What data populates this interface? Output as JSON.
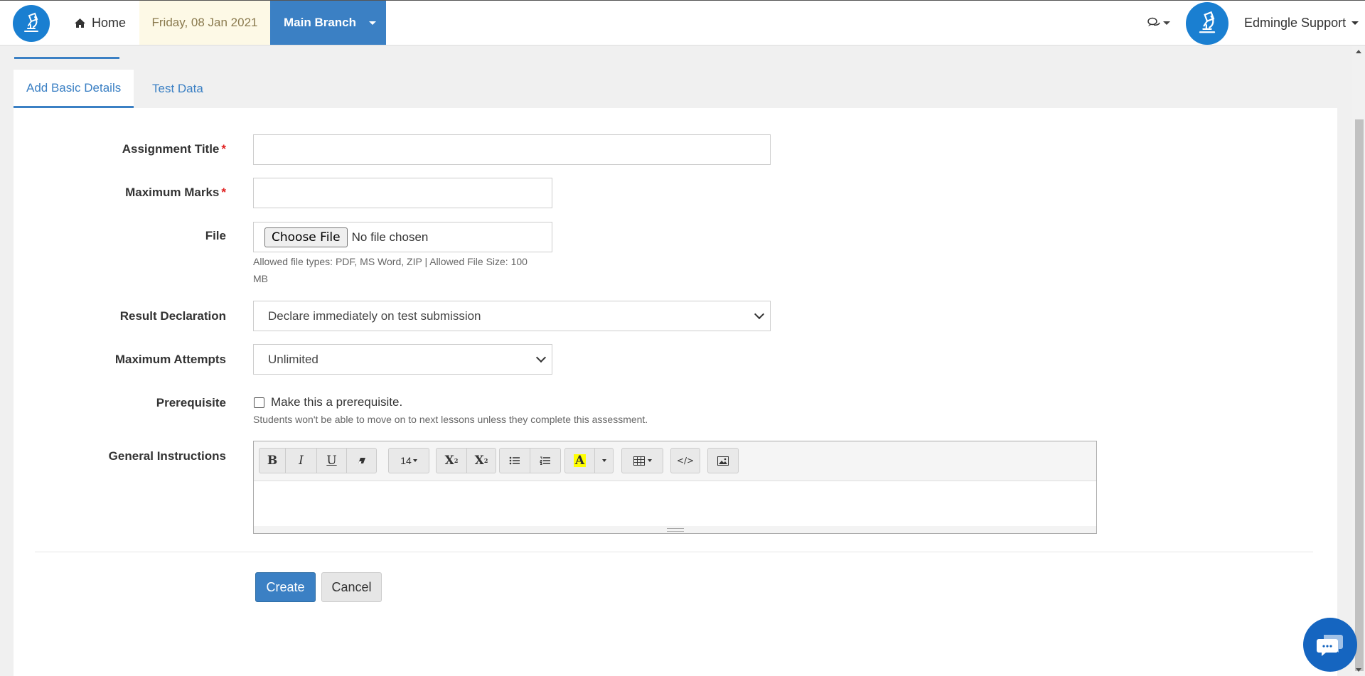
{
  "navbar": {
    "home_label": "Home",
    "date": "Friday, 08 Jan 2021",
    "branch": "Main Branch",
    "user_name": "Edmingle Support"
  },
  "tabs": [
    {
      "label": "Add Basic Details",
      "active": true
    },
    {
      "label": "Test Data",
      "active": false
    }
  ],
  "form": {
    "assignment_title": {
      "label": "Assignment Title",
      "required": "*",
      "value": ""
    },
    "maximum_marks": {
      "label": "Maximum Marks",
      "required": "*",
      "value": ""
    },
    "file": {
      "label": "File",
      "button_label": "Choose File",
      "status": "No file chosen",
      "help": "Allowed file types: PDF, MS Word, ZIP | Allowed File Size: 100 MB"
    },
    "result_declaration": {
      "label": "Result Declaration",
      "selected": "Declare immediately on test submission"
    },
    "maximum_attempts": {
      "label": "Maximum Attempts",
      "selected": "Unlimited"
    },
    "prerequisite": {
      "label": "Prerequisite",
      "checkbox_label": "Make this a prerequisite.",
      "checked": false,
      "help": "Students won't be able to move on to next lessons unless they complete this assessment."
    },
    "general_instructions": {
      "label": "General Instructions",
      "toolbar": {
        "bold": "B",
        "italic": "I",
        "underline": "U",
        "font_size": "14",
        "superscript": "X",
        "superscript_mark": "2",
        "subscript": "X",
        "subscript_mark": "2",
        "highlight": "A",
        "highlight_color": "#ffff00",
        "code": "</>"
      }
    }
  },
  "actions": {
    "create": "Create",
    "cancel": "Cancel"
  },
  "colors": {
    "primary": "#3b80c4",
    "date_bg": "#fdf9e6",
    "required": "#e02020",
    "chat_fab": "#1565c0"
  }
}
